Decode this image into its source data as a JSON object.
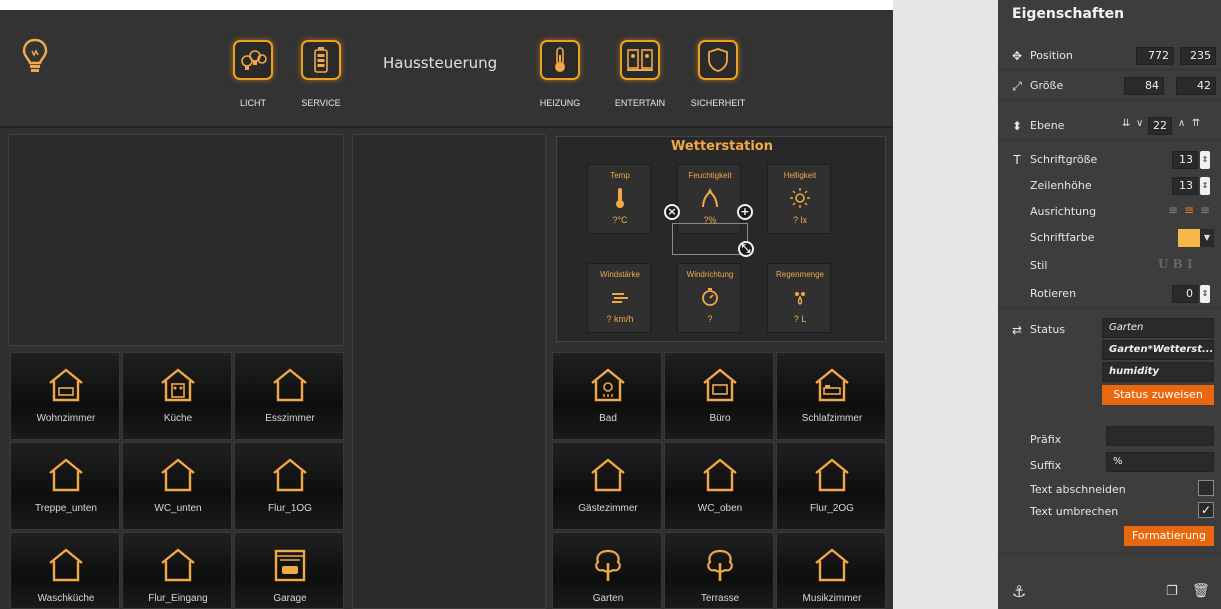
{
  "header": {
    "title": "Haussteuerung",
    "buttons": [
      {
        "label": "LICHT",
        "icon": "bulbs-icon"
      },
      {
        "label": "SERVICE",
        "icon": "battery-icon"
      },
      {
        "label": "HEIZUNG",
        "icon": "thermometer-icon"
      },
      {
        "label": "ENTERTAIN",
        "icon": "speakers-icon"
      },
      {
        "label": "SICHERHEIT",
        "icon": "shield-icon"
      }
    ]
  },
  "weather": {
    "title": "Wetterstation",
    "cells": [
      {
        "label": "Temp",
        "value": "?°C",
        "icon": "thermometer-icon"
      },
      {
        "label": "Feuchtigkeit",
        "value": "?%",
        "icon": "humidity-icon"
      },
      {
        "label": "Helligkeit",
        "value": "? lx",
        "icon": "sun-icon"
      },
      {
        "label": "Windstärke",
        "value": "? km/h",
        "icon": "wind-icon"
      },
      {
        "label": "Windrichtung",
        "value": "?",
        "icon": "compass-icon"
      },
      {
        "label": "Regenmenge",
        "value": "? L",
        "icon": "raindrops-icon"
      }
    ]
  },
  "rooms_left": [
    {
      "label": "Wohnzimmer",
      "icon": "house-sofa-icon"
    },
    {
      "label": "Küche",
      "icon": "house-stove-icon"
    },
    {
      "label": "Esszimmer",
      "icon": "house-icon"
    },
    {
      "label": "Treppe_unten",
      "icon": "house-icon"
    },
    {
      "label": "WC_unten",
      "icon": "house-icon"
    },
    {
      "label": "Flur_1OG",
      "icon": "house-icon"
    },
    {
      "label": "Waschküche",
      "icon": "house-icon"
    },
    {
      "label": "Flur_Eingang",
      "icon": "house-icon"
    },
    {
      "label": "Garage",
      "icon": "garage-icon"
    }
  ],
  "rooms_right": [
    {
      "label": "Bad",
      "icon": "house-shower-icon"
    },
    {
      "label": "Büro",
      "icon": "house-desk-icon"
    },
    {
      "label": "Schlafzimmer",
      "icon": "house-bed-icon"
    },
    {
      "label": "Gästezimmer",
      "icon": "house-icon"
    },
    {
      "label": "WC_oben",
      "icon": "house-icon"
    },
    {
      "label": "Flur_2OG",
      "icon": "house-icon"
    },
    {
      "label": "Garten",
      "icon": "tree-icon"
    },
    {
      "label": "Terrasse",
      "icon": "tree-icon"
    },
    {
      "label": "Musikzimmer",
      "icon": "house-icon"
    }
  ],
  "props": {
    "title": "Eigenschaften",
    "position_label": "Position",
    "position_x": "772",
    "position_y": "235",
    "size_label": "Größe",
    "size_w": "84",
    "size_h": "42",
    "layer_label": "Ebene",
    "layer_value": "22",
    "fontsize_label": "Schriftgröße",
    "fontsize_value": "13",
    "lineheight_label": "Zeilenhöhe",
    "lineheight_value": "13",
    "align_label": "Ausrichtung",
    "fontcolor_label": "Schriftfarbe",
    "fontcolor": "#f7b84a",
    "style_label": "Stil",
    "style_letters": "U B I",
    "rotate_label": "Rotieren",
    "rotate_value": "0",
    "status_label": "Status",
    "status_values": [
      "Garten",
      "Garten*Wetterst...",
      "humidity"
    ],
    "assign_status": "Status zuweisen",
    "prefix_label": "Präfix",
    "prefix_value": "",
    "suffix_label": "Suffix",
    "suffix_value": "%",
    "cut_label": "Text abschneiden",
    "cut_checked": false,
    "wrap_label": "Text umbrechen",
    "wrap_checked": true,
    "format_button": "Formatierung"
  },
  "colors": {
    "accent": "#f0a020",
    "props_bg": "#3d3d3d",
    "button_orange": "#e8680e"
  }
}
